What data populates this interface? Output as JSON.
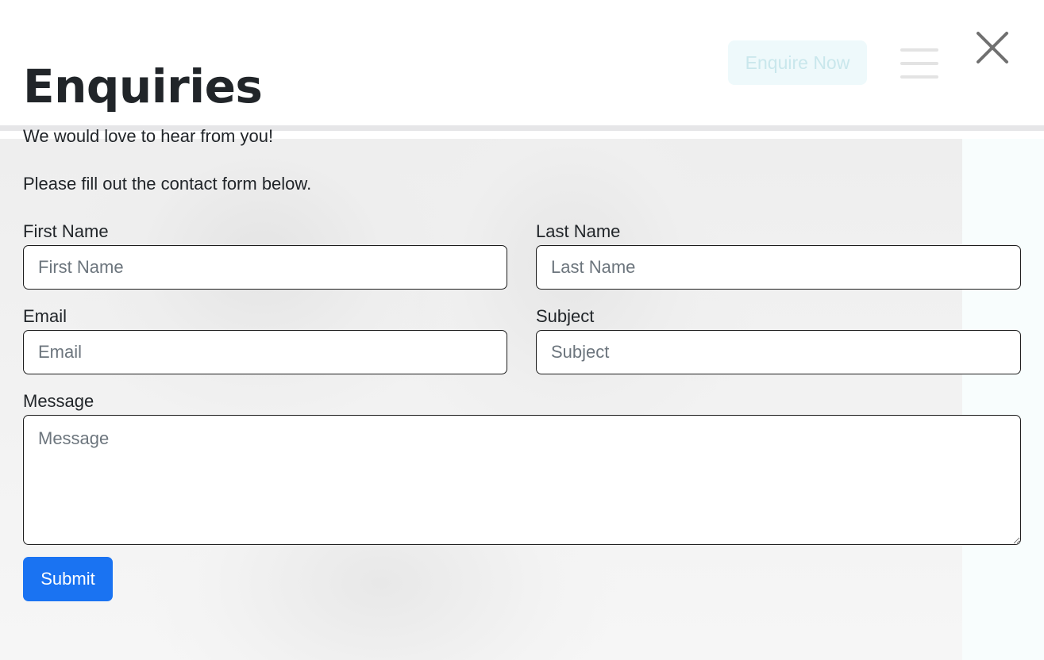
{
  "header": {
    "enquire_label": "Enquire Now"
  },
  "modal": {
    "title": "Enquiries",
    "intro_line_1": "We would love to hear from you!",
    "intro_line_2": "Please fill out the contact form below."
  },
  "form": {
    "first_name": {
      "label": "First Name",
      "placeholder": "First Name",
      "value": ""
    },
    "last_name": {
      "label": "Last Name",
      "placeholder": "Last Name",
      "value": ""
    },
    "email": {
      "label": "Email",
      "placeholder": "Email",
      "value": ""
    },
    "subject": {
      "label": "Subject",
      "placeholder": "Subject",
      "value": ""
    },
    "message": {
      "label": "Message",
      "placeholder": "Message",
      "value": ""
    },
    "submit_label": "Submit"
  },
  "colors": {
    "primary": "#1a73f2",
    "text": "#212529",
    "placeholder": "#6c757d",
    "close_icon": "#707070"
  },
  "icons": {
    "close": "close-icon",
    "menu": "hamburger-menu-icon"
  }
}
